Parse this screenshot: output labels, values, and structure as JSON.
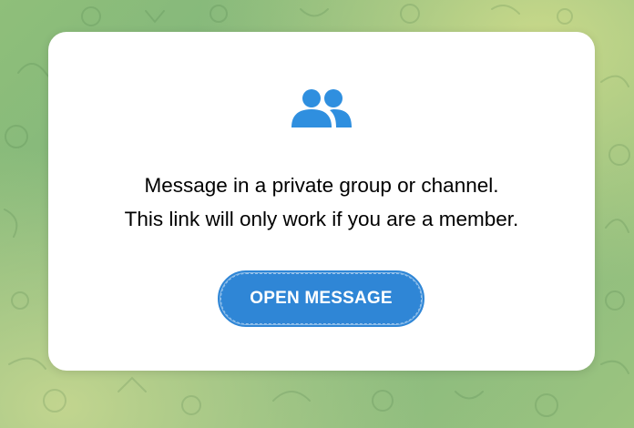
{
  "dialog": {
    "icon": "group-icon",
    "message_line1": "Message in a private group or channel.",
    "message_line2": "This link will only work if you are a member.",
    "open_button_label": "OPEN MESSAGE"
  },
  "colors": {
    "accent": "#2f86d6",
    "icon": "#2f8fdf",
    "card": "#ffffff",
    "background_green": "#86b87e",
    "background_yellow": "#c9d98a"
  }
}
